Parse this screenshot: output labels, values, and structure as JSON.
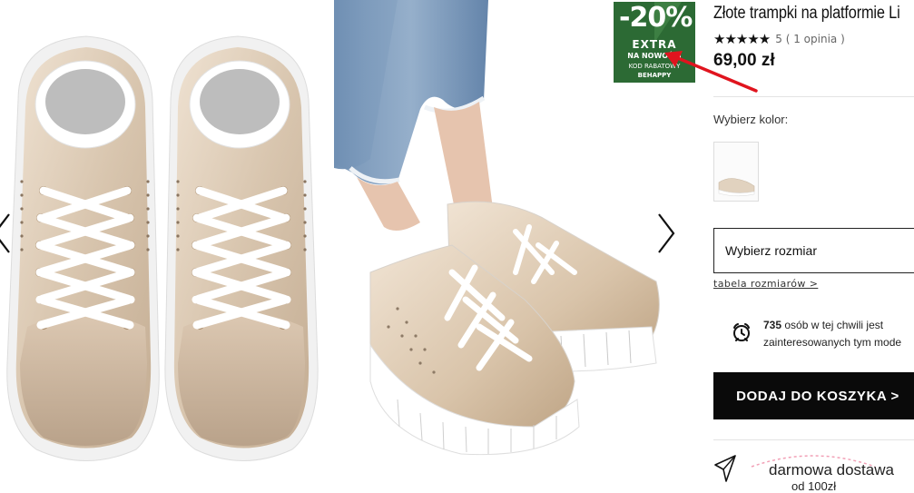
{
  "product": {
    "title": "Złote trampki na platformie Li",
    "rating_stars": "★★★★★",
    "rating_value": "5",
    "reviews": "( 1 opinia )",
    "price": "69,00 zł"
  },
  "promo": {
    "percent": "-20%",
    "extra": "EXTRA",
    "new_items": "NA NOWOŚCI",
    "code_label": "KOD RABATOWY",
    "code": "BEHAPPY",
    "bg_color": "#2c6a34"
  },
  "color_section": {
    "label": "Wybierz kolor:"
  },
  "size": {
    "select_label": "Wybierz rozmiar",
    "table_link": "tabela rozmiarów >"
  },
  "interest": {
    "count": "735",
    "text_1": " osób w tej chwili jest",
    "text_2": "zainteresowanych tym mode"
  },
  "cart": {
    "button_label": "DODAJ DO KOSZYKA >"
  },
  "delivery": {
    "text": "darmowa dostawa",
    "sub": "od 100zł"
  },
  "icons": {
    "prev": "chevron-left-icon",
    "next": "chevron-right-icon",
    "clock": "alarm-clock-icon",
    "plane": "paper-plane-icon",
    "annotation": "red-arrow-icon"
  },
  "colors": {
    "accent": "#0a0a0a",
    "annotation": "#e0141e",
    "promo": "#2c6a34"
  }
}
